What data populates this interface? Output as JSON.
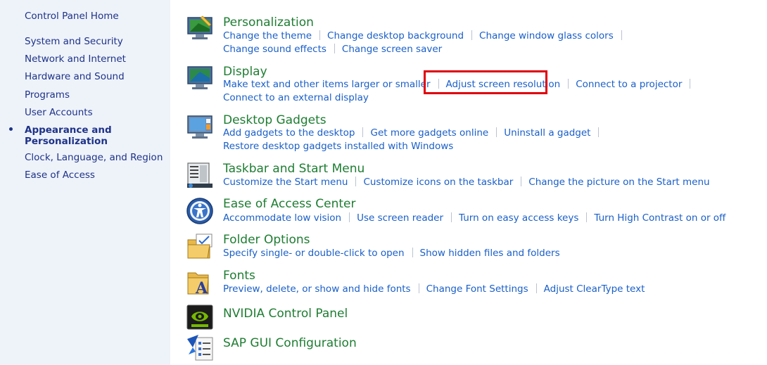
{
  "sidebar": {
    "home": "Control Panel Home",
    "items": [
      "System and Security",
      "Network and Internet",
      "Hardware and Sound",
      "Programs",
      "User Accounts"
    ],
    "current_line1": "Appearance and",
    "current_line2": "Personalization",
    "items_after": [
      "Clock, Language, and Region",
      "Ease of Access"
    ]
  },
  "categories": [
    {
      "title": "Personalization",
      "icon": "personalization-icon",
      "rows": [
        [
          "Change the theme",
          "Change desktop background",
          "Change window glass colors"
        ],
        [
          "Change sound effects",
          "Change screen saver"
        ]
      ]
    },
    {
      "title": "Display",
      "icon": "display-icon",
      "rows": [
        [
          "Make text and other items larger or smaller",
          "Adjust screen resolution",
          "Connect to a projector"
        ],
        [
          "Connect to an external display"
        ]
      ]
    },
    {
      "title": "Desktop Gadgets",
      "icon": "desktop-gadgets-icon",
      "rows": [
        [
          "Add gadgets to the desktop",
          "Get more gadgets online",
          "Uninstall a gadget"
        ],
        [
          "Restore desktop gadgets installed with Windows"
        ]
      ]
    },
    {
      "title": "Taskbar and Start Menu",
      "icon": "taskbar-icon",
      "rows": [
        [
          "Customize the Start menu",
          "Customize icons on the taskbar",
          "Change the picture on the Start menu"
        ]
      ]
    },
    {
      "title": "Ease of Access Center",
      "icon": "ease-of-access-icon",
      "rows": [
        [
          "Accommodate low vision",
          "Use screen reader",
          "Turn on easy access keys",
          "Turn High Contrast on or off"
        ]
      ]
    },
    {
      "title": "Folder Options",
      "icon": "folder-options-icon",
      "rows": [
        [
          "Specify single- or double-click to open",
          "Show hidden files and folders"
        ]
      ]
    },
    {
      "title": "Fonts",
      "icon": "fonts-icon",
      "rows": [
        [
          "Preview, delete, or show and hide fonts",
          "Change Font Settings",
          "Adjust ClearType text"
        ]
      ]
    },
    {
      "title": "NVIDIA Control Panel",
      "icon": "nvidia-icon",
      "rows": []
    },
    {
      "title": "SAP GUI Configuration",
      "icon": "sap-gui-icon",
      "rows": []
    }
  ],
  "colors": {
    "sidebar_bg": "#eef3fa",
    "title_green": "#1e7d32",
    "link_blue": "#1a5fc8",
    "highlight_red": "#e0000b"
  }
}
